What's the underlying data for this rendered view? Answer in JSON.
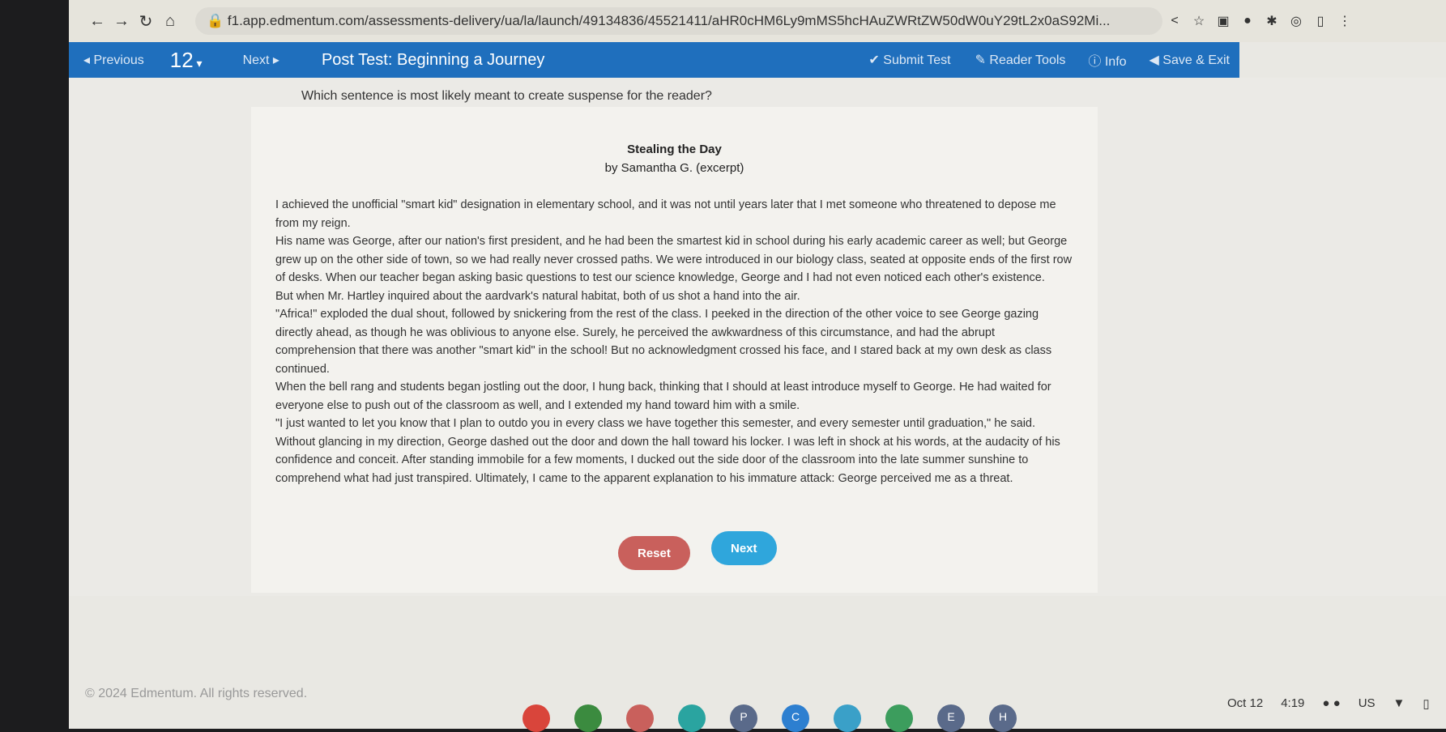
{
  "browser": {
    "url": "f1.app.edmentum.com/assessments-delivery/ua/la/launch/49134836/45521411/aHR0cHM6Ly9mMS5hcHAuZWRtZW50dW0uY29tL2x0aS92Mi..."
  },
  "toolbar": {
    "previous": "Previous",
    "question_number": "12",
    "next": "Next",
    "title": "Post Test: Beginning a Journey",
    "submit": "Submit Test",
    "reader_tools": "Reader Tools",
    "info": "Info",
    "save_exit": "Save & Exit"
  },
  "question": "Which sentence is most likely meant to create suspense for the reader?",
  "passage": {
    "title": "Stealing the Day",
    "author": "by Samantha G. (excerpt)",
    "paragraphs": [
      "I achieved the unofficial \"smart kid\" designation in elementary school, and it was not until years later that I met someone who threatened to depose me from my reign.",
      "His name was George, after our nation's first president, and he had been the smartest kid in school during his early academic career as well; but George grew up on the other side of town, so we had really never crossed paths. We were introduced in our biology class, seated at opposite ends of the first row of desks. When our teacher began asking basic questions to test our science knowledge, George and I had not even noticed each other's existence.",
      "But when Mr. Hartley inquired about the aardvark's natural habitat, both of us shot a hand into the air.",
      "\"Africa!\" exploded the dual shout, followed by snickering from the rest of the class. I peeked in the direction of the other voice to see George gazing directly ahead, as though he was oblivious to anyone else. Surely, he perceived the awkwardness of this circumstance, and had the abrupt comprehension that there was another \"smart kid\" in the school! But no acknowledgment crossed his face, and I stared back at my own desk as class continued.",
      "When the bell rang and students began jostling out the door, I hung back, thinking that I should at least introduce myself to George. He had waited for everyone else to push out of the classroom as well, and I extended my hand toward him with a smile.",
      "\"I just wanted to let you know that I plan to outdo you in every class we have together this semester, and every semester until graduation,\" he said.",
      "Without glancing in my direction, George dashed out the door and down the hall toward his locker. I was left in shock at his words, at the audacity of his confidence and conceit. After standing immobile for a few moments, I ducked out the side door of the classroom into the late summer sunshine to comprehend what had just transpired. Ultimately, I came to the apparent explanation to his immature attack: George perceived me as a threat."
    ]
  },
  "buttons": {
    "reset": "Reset",
    "next": "Next"
  },
  "footer": "© 2024 Edmentum. All rights reserved.",
  "shelf": {
    "apps": [
      "",
      "",
      "",
      "",
      "P",
      "C",
      "",
      "",
      "E",
      "H"
    ]
  },
  "tray": {
    "date": "Oct 12",
    "time": "4:19",
    "locale": "US"
  },
  "colors": {
    "toolbar": "#1f6fbd",
    "reset": "#c9605c",
    "next": "#2fa6dc"
  }
}
